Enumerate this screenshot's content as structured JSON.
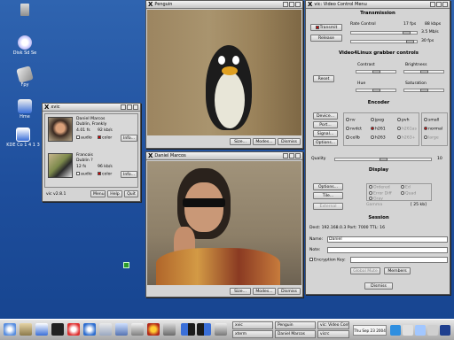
{
  "desktop": {
    "icons": [
      {
        "label": "",
        "icon": "trash-icon",
        "color": "#bbbbbb"
      },
      {
        "label": "Disk Sd Se",
        "icon": "disk-icon",
        "color": "#ffffff"
      },
      {
        "label": "Fpy",
        "icon": "floppy-icon",
        "color": "#e0e0e0"
      },
      {
        "label": "Hme",
        "icon": "home-icon",
        "color": "#dddddd"
      },
      {
        "label": "KDE Co 1 4 1 3",
        "icon": "kde-icon",
        "color": "#3a6fd8"
      }
    ]
  },
  "xawtv": {
    "title": "xvic",
    "participants": [
      {
        "name": "Daniel Marcos",
        "host": "Dublin, Frankly",
        "fps": "4.01 fs",
        "rate": "92 kb/s",
        "chk_audio": "audio",
        "chk_color": "color",
        "info": "Info..."
      },
      {
        "name": "Francois",
        "host": "Dublin ?",
        "fps": "12 fs",
        "rate": "96 kb/s",
        "chk_audio": "audio",
        "chk_color": "color",
        "info": "Info..."
      }
    ],
    "version": "vic v2.8.1",
    "buttons": {
      "menu": "Menu",
      "help": "Help",
      "quit": "Quit"
    }
  },
  "penguin_win": {
    "title": "Penguin",
    "buttons": {
      "size": "Size...",
      "modes": "Modes...",
      "dismiss": "Dismiss"
    }
  },
  "person_win": {
    "title": "Daniel Marcos",
    "buttons": {
      "size": "Size...",
      "modes": "Modes...",
      "dismiss": "Dismiss"
    }
  },
  "control": {
    "title": "vic: Video Control Menu",
    "transmission": {
      "header": "Transmission",
      "transmit": "Transmit",
      "release": "Release",
      "rate_control": "Rate Control",
      "fps_label": "17 fps",
      "kbps_label": "88 kbps",
      "max_bw": "3.5 Mb/s",
      "max_fps": "30 fps"
    },
    "grabber": {
      "header": "Video4Linux grabber controls",
      "reset": "Reset",
      "contrast": "Contrast",
      "brightness": "Brightness",
      "hue": "Hue",
      "saturation": "Saturation"
    },
    "encoder": {
      "header": "Encoder",
      "device": "Device...",
      "port": "Port...",
      "signal": "Signal...",
      "options": "Options...",
      "codecs": [
        [
          "nv",
          "jpeg",
          "pvh"
        ],
        [
          "nvdct",
          "h261",
          "h261as"
        ],
        [
          "cellb",
          "h263",
          "h263+"
        ]
      ],
      "sizes": [
        "small",
        "normal",
        "large"
      ],
      "quality_label": "Quality",
      "quality_value": "10"
    },
    "display": {
      "header": "Display",
      "options": "Options...",
      "tile": "Tile...",
      "external": "External",
      "dither": [
        "Ordered",
        "Ed",
        "Error Diff",
        "Quad",
        "Gray"
      ],
      "gamma_label": "Gamma",
      "gamma_value": "[ 25 kb]"
    },
    "session": {
      "header": "Session",
      "dest": "Dest: 192.168.0.3 Port: 7000 TTL: 16",
      "name_label": "Name:",
      "name_value": "Daniel",
      "note_label": "Note:",
      "note_value": "",
      "key_label": "Encryption Key:",
      "global_mute": "Global Mute",
      "members": "Members",
      "dismiss": "Dismiss"
    }
  },
  "taskbar": {
    "tasks": [
      "xvic",
      "xterm",
      "Penguin",
      "Daniel Marcos",
      "vic: Video Control",
      "vicrc"
    ],
    "clock": "Thu Sep 23 2004"
  }
}
